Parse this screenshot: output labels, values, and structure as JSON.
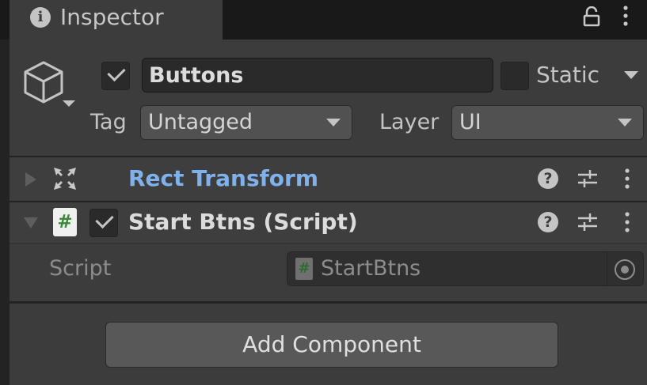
{
  "window": {
    "tab_title": "Inspector",
    "info_icon": "info-icon",
    "lock_icon": "lock-icon",
    "menu_icon": "kebab-menu-icon"
  },
  "game_object": {
    "icon": "cube-icon",
    "active": true,
    "name": "Buttons",
    "static_checked": false,
    "static_label": "Static",
    "tag_label": "Tag",
    "tag_value": "Untagged",
    "layer_label": "Layer",
    "layer_value": "UI"
  },
  "components": [
    {
      "title": "Rect Transform",
      "icon": "rect-transform-icon",
      "expanded": false,
      "title_color": "#7fb1ec"
    },
    {
      "title": "Start Btns (Script)",
      "icon": "csharp-script-icon",
      "file_glyph": "#",
      "expanded": true,
      "enabled": true,
      "fields": [
        {
          "label": "Script",
          "value": "StartBtns",
          "icon": "csharp-script-icon"
        }
      ]
    }
  ],
  "help_glyph": "?",
  "info_glyph": "i",
  "add_component_label": "Add Component",
  "colors": {
    "panel_bg": "#3c3c3c",
    "window_bg": "#191919",
    "link_blue": "#7fb1ec"
  }
}
